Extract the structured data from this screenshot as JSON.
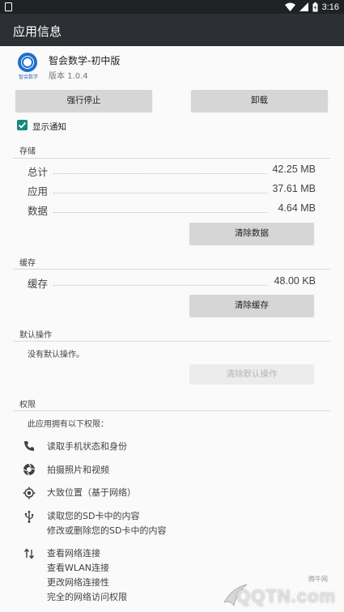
{
  "status_bar": {
    "time": "3:16"
  },
  "app_bar": {
    "title": "应用信息"
  },
  "app": {
    "icon_caption": "智会数学",
    "name": "智会数学-初中版",
    "version": "版本 1.0.4"
  },
  "actions": {
    "force_stop": "强行停止",
    "uninstall": "卸载"
  },
  "notifications": {
    "label": "显示通知",
    "checked": true
  },
  "storage": {
    "title": "存储",
    "rows": [
      {
        "label": "总计",
        "value": "42.25 MB"
      },
      {
        "label": "应用",
        "value": "37.61 MB"
      },
      {
        "label": "数据",
        "value": "4.64 MB"
      }
    ],
    "clear_button": "清除数据"
  },
  "cache": {
    "title": "缓存",
    "rows": [
      {
        "label": "缓存",
        "value": "48.00 KB"
      }
    ],
    "clear_button": "清除缓存"
  },
  "defaults": {
    "title": "默认操作",
    "text": "没有默认操作。",
    "clear_button": "清除默认操作"
  },
  "permissions": {
    "title": "权限",
    "intro": "此应用拥有以下权限：",
    "items": [
      {
        "icon": "phone-icon",
        "lines": [
          "读取手机状态和身份"
        ]
      },
      {
        "icon": "camera-icon",
        "lines": [
          "拍摄照片和视频"
        ]
      },
      {
        "icon": "location-icon",
        "lines": [
          "大致位置（基于网络）"
        ]
      },
      {
        "icon": "usb-icon",
        "lines": [
          "读取您的SD卡中的内容",
          "修改或删除您的SD卡中的内容"
        ]
      },
      {
        "icon": "network-icon",
        "lines": [
          "查看网络连接",
          "查看WLAN连接",
          "更改网络连接性",
          "完全的网络访问权限"
        ]
      }
    ]
  },
  "watermark": {
    "brand": "QQTN.com",
    "caption": "腾牛网"
  },
  "colors": {
    "accent": "#17897c",
    "app_bar": "#2c2f33",
    "status_bar": "#1f2124"
  }
}
